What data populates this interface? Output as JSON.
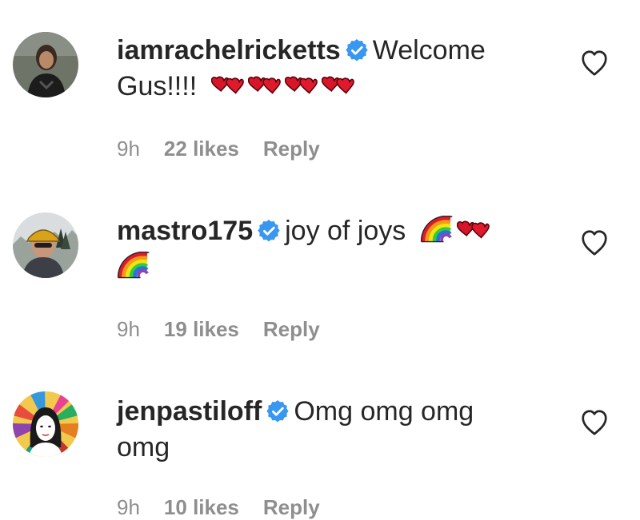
{
  "comments": [
    {
      "username": "iamrachelricketts",
      "verified": true,
      "text_line1": "Welcome",
      "text_line2": "Gus!!!!",
      "emojis": [
        "two-hearts",
        "two-hearts",
        "two-hearts",
        "two-hearts"
      ],
      "time": "9h",
      "likes": "22 likes",
      "reply": "Reply"
    },
    {
      "username": "mastro175",
      "verified": true,
      "text_line1": "joy of joys",
      "emojis_line1": [
        "rainbow",
        "two-hearts"
      ],
      "emojis_line2": [
        "rainbow"
      ],
      "time": "9h",
      "likes": "19 likes",
      "reply": "Reply"
    },
    {
      "username": "jenpastiloff",
      "verified": true,
      "text_line1": "Omg omg omg",
      "text_line2": "omg",
      "time": "9h",
      "likes": "10 likes",
      "reply": "Reply"
    }
  ],
  "colors": {
    "verified": "#3897f0",
    "meta": "#8e8e8e",
    "text": "#262626",
    "heart": "#e0192d"
  }
}
